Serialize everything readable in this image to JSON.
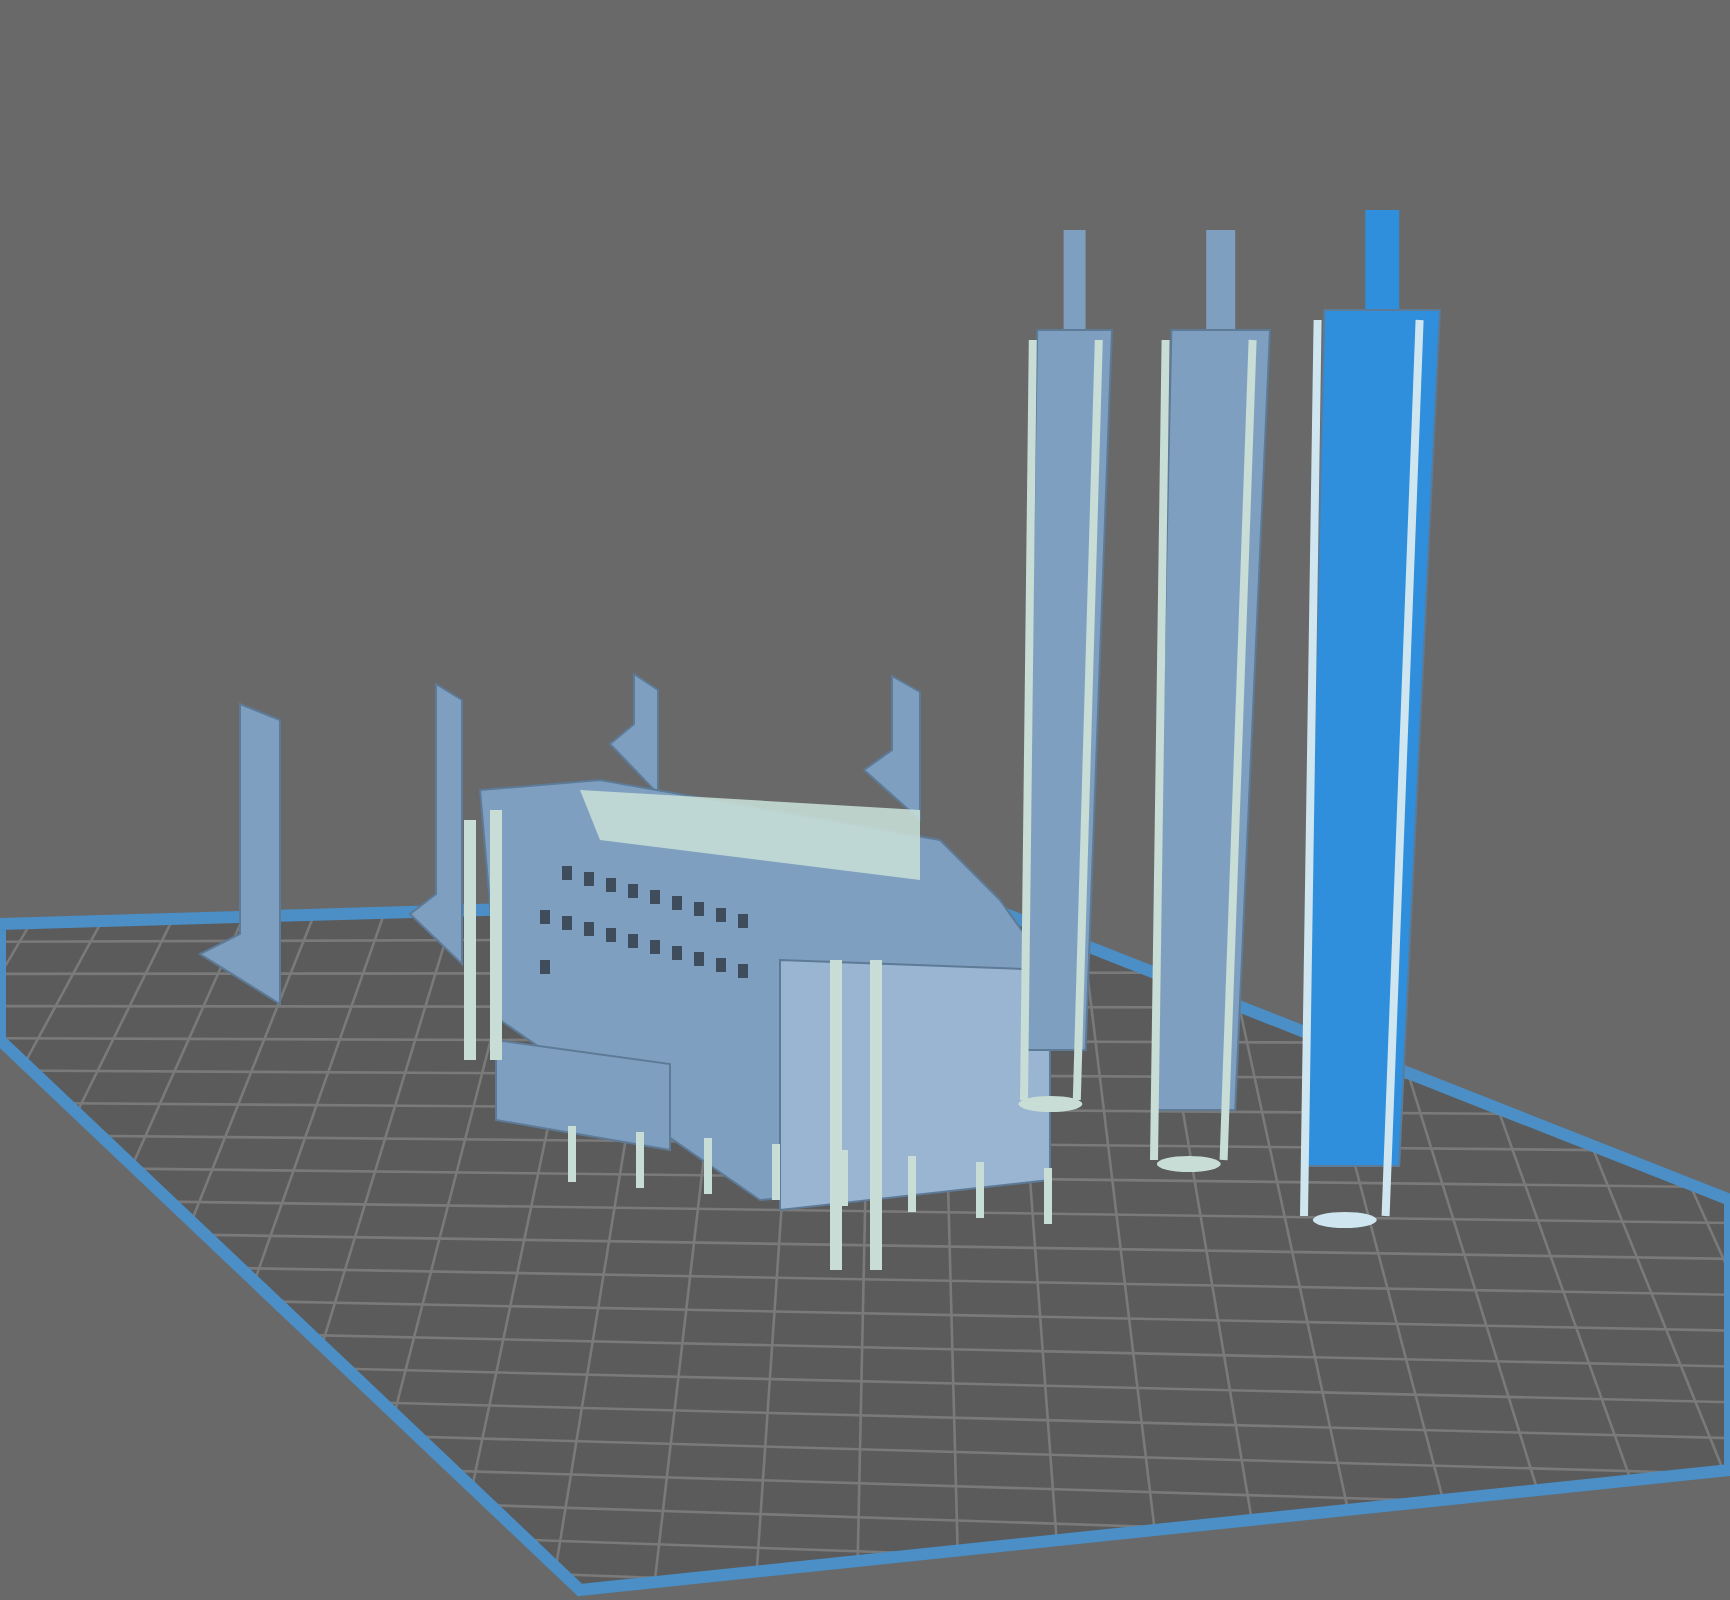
{
  "viewport": {
    "objects": [
      {
        "kind": "panel",
        "selected": false
      },
      {
        "kind": "panel",
        "selected": false
      },
      {
        "kind": "panel",
        "selected": false
      },
      {
        "kind": "panel",
        "selected": false
      },
      {
        "kind": "building",
        "selected": false
      },
      {
        "kind": "chimney",
        "selected": false
      },
      {
        "kind": "chimney",
        "selected": false
      },
      {
        "kind": "chimney",
        "selected": true
      }
    ]
  }
}
